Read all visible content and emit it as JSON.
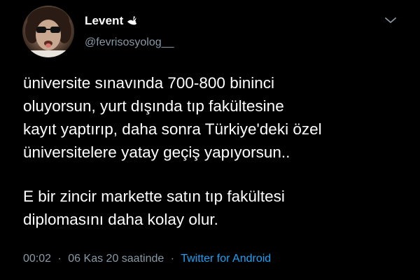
{
  "author": {
    "display_name": "Levent",
    "handle": "@fevrisosyolog__"
  },
  "tweet": {
    "lines_p1": [
      "üniversite sınavında 700-800 bininci",
      "oluyorsun, yurt dışında tıp fakültesine",
      "kayıt yaptırıp, daha sonra Türkiye'deki özel",
      "üniversitelere yatay geçiş yapıyorsun.."
    ],
    "lines_p2": [
      "E bir zincir markette satın tıp fakültesi",
      "diplomasını daha kolay olur."
    ]
  },
  "meta": {
    "time": "00:02",
    "separator": "·",
    "date": "06 Kas 20 saatinde",
    "source": "Twitter for Android"
  },
  "icons": {
    "name_badge": "dove-icon",
    "menu": "chevron-down-icon"
  },
  "colors": {
    "background": "#000000",
    "text": "#ffffff",
    "secondary": "#8899a6",
    "link": "#1da1f2"
  }
}
